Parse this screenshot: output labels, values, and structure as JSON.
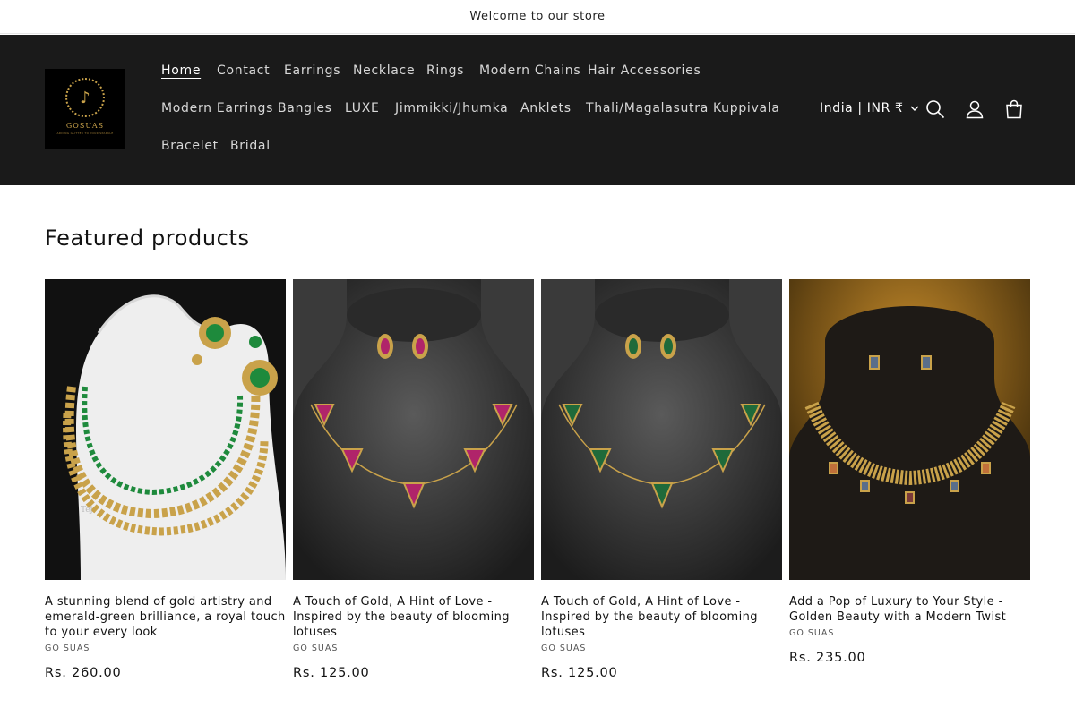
{
  "announcement": {
    "text": "Welcome to our store"
  },
  "header": {
    "logo": {
      "name": "GOSUAS",
      "tagline": "ADDING GLITTER TO YOUR SPARKLE"
    },
    "nav": [
      {
        "label": "Home",
        "active": true
      },
      {
        "label": "Contact"
      },
      {
        "label": "Earrings"
      },
      {
        "label": "Necklace"
      },
      {
        "label": "Rings"
      },
      {
        "label": "Modern Chains"
      },
      {
        "label": "Hair Accessories"
      },
      {
        "label": "Modern Earrings"
      },
      {
        "label": "Bangles"
      },
      {
        "label": "LUXE"
      },
      {
        "label": "Jimmikki/Jhumka"
      },
      {
        "label": "Anklets"
      },
      {
        "label": "Thali/Magalasutra"
      },
      {
        "label": "Kuppivala"
      },
      {
        "label": "Bracelet"
      },
      {
        "label": "Bridal"
      }
    ],
    "country_selector": "India | INR ₹",
    "icons": [
      "search-icon",
      "account-icon",
      "cart-icon"
    ]
  },
  "featured": {
    "title": "Featured products",
    "products": [
      {
        "title": "A stunning blend of gold artistry and emerald-green brilliance, a royal touch to your every look",
        "vendor": "GO SUAS",
        "price": "Rs. 260.00",
        "image_watermark": "Tej",
        "stone_color": "#1e8a3c"
      },
      {
        "title": "A Touch of Gold, A Hint of Love - Inspired by the beauty of blooming lotuses",
        "vendor": "GO SUAS",
        "price": "Rs. 125.00",
        "stone_color": "#b0246a"
      },
      {
        "title": "A Touch of Gold, A Hint of Love - Inspired by the beauty of blooming lotuses",
        "vendor": "GO SUAS",
        "price": "Rs. 125.00",
        "stone_color": "#1f6a3a"
      },
      {
        "title": "Add a Pop of Luxury to Your Style - Golden Beauty with a Modern Twist",
        "vendor": "GO SUAS",
        "price": "Rs. 235.00",
        "stone_color": "#5a6e8a"
      }
    ]
  },
  "colors": {
    "header_bg": "#1a1a1a",
    "gold": "#c9a24a",
    "text": "#121212"
  }
}
